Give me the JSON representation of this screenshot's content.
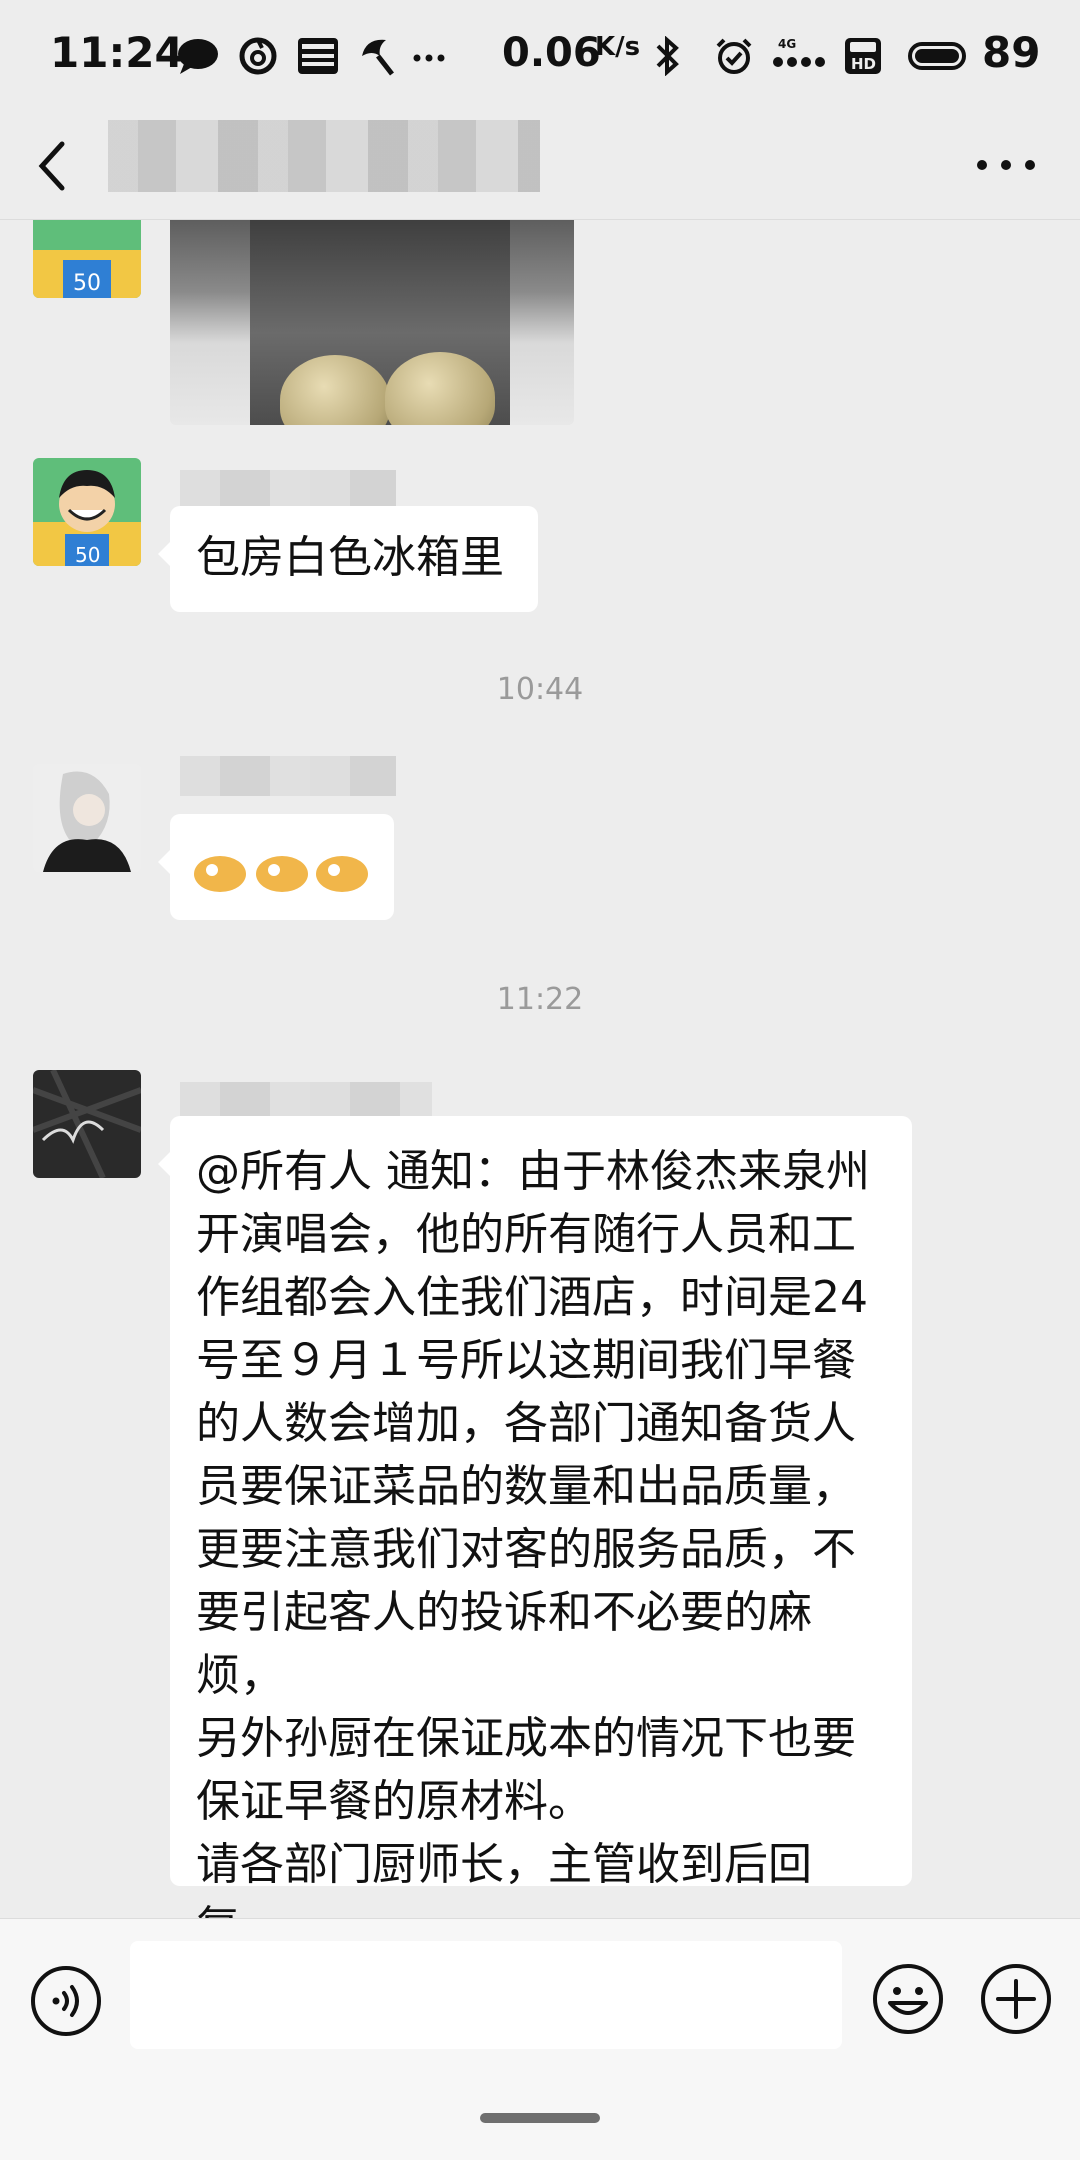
{
  "status_bar": {
    "time": "11:24",
    "network_speed": "0.06",
    "network_speed_unit": "K/s",
    "network_type": "4G",
    "battery_level": "89",
    "icons": [
      "chat-bubble-icon",
      "netease-music-icon",
      "news-icon",
      "app-icon",
      "more-notifications-icon",
      "bluetooth-icon",
      "alarm-icon",
      "signal-icon",
      "hd-icon",
      "battery-icon"
    ]
  },
  "nav_bar": {
    "back_icon": "chevron-left-icon",
    "more_icon": "more-dots-icon"
  },
  "messages": [
    {
      "type": "image",
      "description_icon": "photo-message"
    },
    {
      "type": "text",
      "text": "包房白色冰箱里"
    },
    {
      "type": "timestamp",
      "text": "10:44"
    },
    {
      "type": "sticker",
      "icon": "ok-hand-emoji"
    },
    {
      "type": "timestamp",
      "text": "11:22"
    },
    {
      "type": "text",
      "text": "@所有人 通知：由于林俊杰来泉州\n开演唱会，他的所有随行人员和工\n作组都会入住我们酒店，时间是24\n号至９月１号所以这期间我们早餐\n的人数会增加，各部门通知备货人\n员要保证菜品的数量和出品质量，\n更要注意我们对客的服务品质，不\n要引起客人的投诉和不必要的麻烦，\n另外孙厨在保证成本的情况下也要\n保证早餐的原材料。\n请各部门厨师长，主管收到后回复。"
    }
  ],
  "input_bar": {
    "placeholder": "",
    "value": ""
  },
  "colors": {
    "background": "#ededed",
    "bubble": "#ffffff",
    "timestamp": "#9a9a9a",
    "input_bar": "#f7f7f7"
  }
}
